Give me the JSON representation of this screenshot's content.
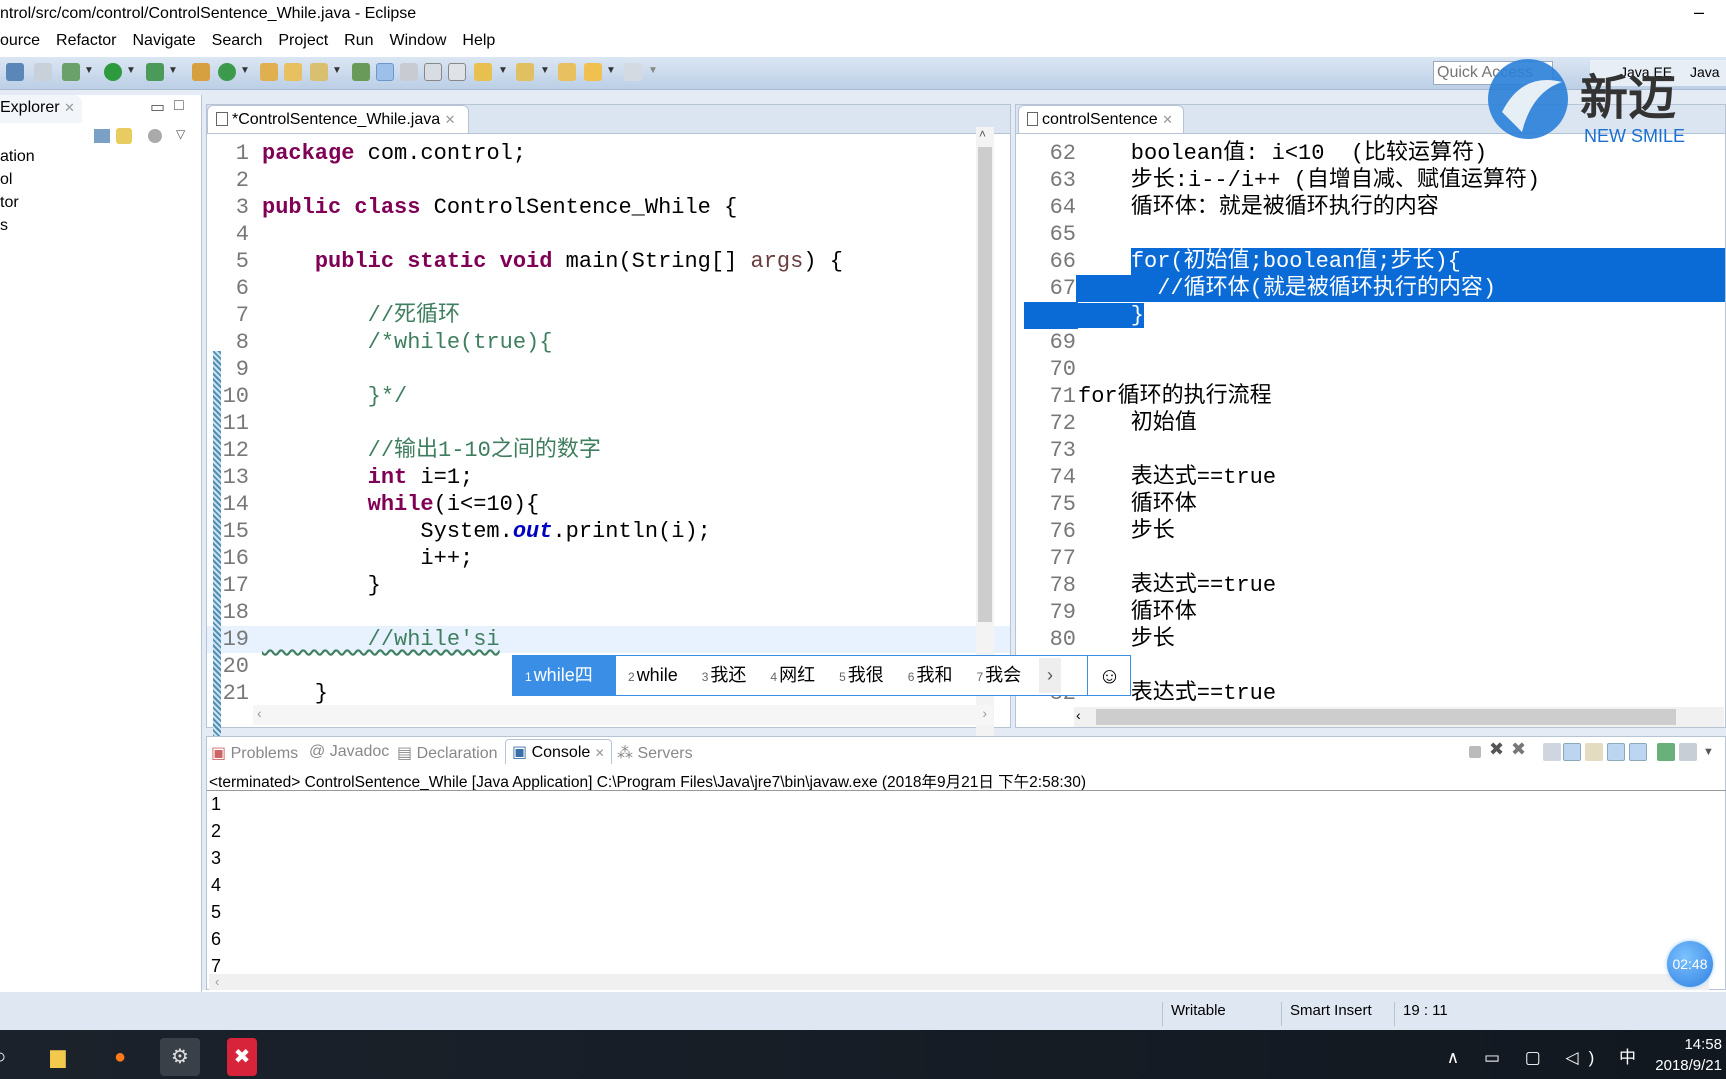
{
  "window": {
    "title": "ntrol/src/com/control/ControlSentence_While.java - Eclipse",
    "minimize": "–"
  },
  "menu": [
    "ource",
    "Refactor",
    "Navigate",
    "Search",
    "Project",
    "Run",
    "Window",
    "Help"
  ],
  "toolbar": {
    "quick_access_placeholder": "Quick Access",
    "perspectives": [
      "Java EE",
      "Java"
    ]
  },
  "logo": {
    "text": "新迈",
    "subtext": "NEW SMILE",
    "color": "#1a6fd0"
  },
  "explorer": {
    "tab": "Explorer",
    "items": [
      "ation",
      "ol",
      "tor",
      "s"
    ]
  },
  "editor": {
    "tab": "*ControlSentence_While.java",
    "lines": [
      {
        "n": "1",
        "seg": [
          [
            "kw",
            "package"
          ],
          [
            "pl",
            " com.control;"
          ]
        ]
      },
      {
        "n": "2",
        "seg": []
      },
      {
        "n": "3",
        "seg": [
          [
            "kw",
            "public class"
          ],
          [
            "pl",
            " ControlSentence_While {"
          ]
        ]
      },
      {
        "n": "4",
        "seg": []
      },
      {
        "n": "5",
        "seg": [
          [
            "pl",
            "    "
          ],
          [
            "kw",
            "public static void"
          ],
          [
            "pl",
            " main(String[] "
          ],
          [
            "par",
            "args"
          ],
          [
            "pl",
            ") {"
          ]
        ]
      },
      {
        "n": "6",
        "seg": []
      },
      {
        "n": "7",
        "seg": [
          [
            "cm",
            "        //死循环"
          ]
        ]
      },
      {
        "n": "8",
        "seg": [
          [
            "cm",
            "        /*while(true){"
          ]
        ]
      },
      {
        "n": "9",
        "seg": []
      },
      {
        "n": "10",
        "seg": [
          [
            "cm",
            "        }*/"
          ]
        ]
      },
      {
        "n": "11",
        "seg": []
      },
      {
        "n": "12",
        "seg": [
          [
            "cm",
            "        //输出1-10之间的数字"
          ]
        ]
      },
      {
        "n": "13",
        "seg": [
          [
            "pl",
            "        "
          ],
          [
            "kw",
            "int"
          ],
          [
            "pl",
            " i=1;"
          ]
        ]
      },
      {
        "n": "14",
        "seg": [
          [
            "pl",
            "        "
          ],
          [
            "kw",
            "while"
          ],
          [
            "pl",
            "(i<=10){"
          ]
        ]
      },
      {
        "n": "15",
        "seg": [
          [
            "pl",
            "            System."
          ],
          [
            "fld",
            "out"
          ],
          [
            "pl",
            ".println(i);"
          ]
        ]
      },
      {
        "n": "16",
        "seg": [
          [
            "pl",
            "            i++;"
          ]
        ]
      },
      {
        "n": "17",
        "seg": [
          [
            "pl",
            "        }"
          ]
        ]
      },
      {
        "n": "18",
        "seg": []
      },
      {
        "n": "19",
        "seg": [
          [
            "cm",
            "        //while'si"
          ]
        ]
      },
      {
        "n": "20",
        "seg": []
      },
      {
        "n": "21",
        "seg": [
          [
            "pl",
            "    }"
          ]
        ]
      }
    ],
    "current_line": "19"
  },
  "ime": {
    "candidates": [
      {
        "n": "1",
        "t": "while四"
      },
      {
        "n": "2",
        "t": "while"
      },
      {
        "n": "3",
        "t": "我还"
      },
      {
        "n": "4",
        "t": "网红"
      },
      {
        "n": "5",
        "t": "我很"
      },
      {
        "n": "6",
        "t": "我和"
      },
      {
        "n": "7",
        "t": "我会"
      }
    ],
    "next": "›",
    "emoji": "☺"
  },
  "notes": {
    "tab": "controlSentence",
    "lines": [
      {
        "n": "62",
        "seg": [
          [
            "pl",
            "    boolean值: i<10  (比较运算符)"
          ]
        ]
      },
      {
        "n": "63",
        "seg": [
          [
            "pl",
            "    步长:i--/i++ (自增自减、赋值运算符)"
          ]
        ]
      },
      {
        "n": "64",
        "seg": [
          [
            "pl",
            "    循环体：就是被循环执行的内容"
          ]
        ]
      },
      {
        "n": "65",
        "seg": []
      },
      {
        "n": "66",
        "seg": [
          [
            "pl",
            "    "
          ],
          [
            "sel",
            "for(初始值;boolean值;步长){"
          ]
        ],
        "fullsel": true
      },
      {
        "n": "67",
        "seg": [
          [
            "sel",
            "      //循环体(就是被循环执行的内容)"
          ]
        ],
        "fullsel": true
      },
      {
        "n": "68",
        "seg": [
          [
            "sel",
            "    }"
          ]
        ]
      },
      {
        "n": "69",
        "seg": []
      },
      {
        "n": "70",
        "seg": []
      },
      {
        "n": "71",
        "seg": [
          [
            "pl",
            "for循环的执行流程"
          ]
        ]
      },
      {
        "n": "72",
        "seg": [
          [
            "pl",
            "    初始值"
          ]
        ]
      },
      {
        "n": "73",
        "seg": []
      },
      {
        "n": "74",
        "seg": [
          [
            "pl",
            "    表达式==true"
          ]
        ]
      },
      {
        "n": "75",
        "seg": [
          [
            "pl",
            "    循环体"
          ]
        ]
      },
      {
        "n": "76",
        "seg": [
          [
            "pl",
            "    步长"
          ]
        ]
      },
      {
        "n": "77",
        "seg": []
      },
      {
        "n": "78",
        "seg": [
          [
            "pl",
            "    表达式==true"
          ]
        ]
      },
      {
        "n": "79",
        "seg": [
          [
            "pl",
            "    循环体"
          ]
        ]
      },
      {
        "n": "80",
        "seg": [
          [
            "pl",
            "    步长"
          ]
        ]
      },
      {
        "n": "81",
        "seg": []
      },
      {
        "n": "82",
        "seg": [
          [
            "pl",
            "    表达式==true"
          ]
        ]
      }
    ],
    "selection_color": "#0a6ad6"
  },
  "console": {
    "tabs": [
      "Problems",
      "Javadoc",
      "Declaration",
      "Console",
      "Servers"
    ],
    "active_tab": "Console",
    "status": "<terminated> ControlSentence_While [Java Application] C:\\Program Files\\Java\\jre7\\bin\\javaw.exe (2018年9月21日 下午2:58:30)",
    "output": [
      "1",
      "2",
      "3",
      "4",
      "5",
      "6",
      "7"
    ]
  },
  "statusbar": {
    "writable": "Writable",
    "insert_mode": "Smart Insert",
    "position": "19 : 11"
  },
  "timer": "02:48",
  "taskbar": {
    "tray": "∧ ▭ ▢ ◁) 中",
    "time": "14:58",
    "date": "2018/9/21"
  }
}
